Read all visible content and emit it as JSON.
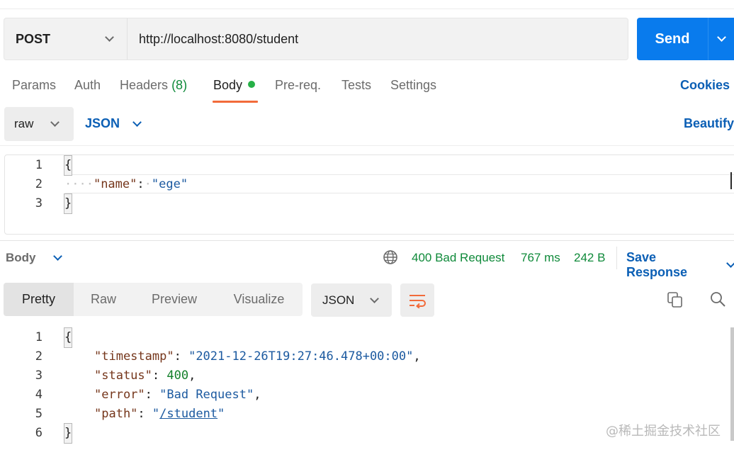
{
  "request": {
    "method": "POST",
    "url": "http://localhost:8080/student",
    "send_label": "Send"
  },
  "request_tabs": {
    "params": "Params",
    "auth": "Auth",
    "headers": "Headers",
    "headers_count": "(8)",
    "body": "Body",
    "prereq": "Pre-req.",
    "tests": "Tests",
    "settings": "Settings",
    "cookies": "Cookies",
    "active": "Body"
  },
  "body_mode": {
    "mode": "raw",
    "language": "JSON",
    "beautify": "Beautify"
  },
  "request_body": {
    "line_numbers": [
      "1",
      "2",
      "3"
    ],
    "open_brace": "{",
    "key": "\"name\"",
    "colon": ":",
    "value": "\"ege\"",
    "close_brace": "}"
  },
  "response": {
    "body_label": "Body",
    "status": "400 Bad Request",
    "time": "767 ms",
    "size": "242 B",
    "save_label": "Save Response"
  },
  "view_tabs": {
    "pretty": "Pretty",
    "raw": "Raw",
    "preview": "Preview",
    "visualize": "Visualize",
    "active": "Pretty",
    "format": "JSON"
  },
  "response_body": {
    "line_numbers": [
      "1",
      "2",
      "3",
      "4",
      "5",
      "6"
    ],
    "open_brace": "{",
    "timestamp_key": "\"timestamp\"",
    "timestamp_value": "\"2021-12-26T19:27:46.478+00:00\"",
    "status_key": "\"status\"",
    "status_value": "400",
    "error_key": "\"error\"",
    "error_value": "\"Bad Request\"",
    "path_key": "\"path\"",
    "path_quote_open": "\"",
    "path_value": "/student",
    "path_quote_close": "\"",
    "close_brace": "}"
  },
  "watermark": "@稀土掘金技术社区",
  "colors": {
    "accent_blue": "#097bed",
    "link_blue": "#0b5fb5",
    "status_green": "#0f8a3a",
    "tab_underline": "#f26b3a",
    "tab_dot": "#26b047"
  },
  "icons": [
    "chevron-down-icon",
    "globe-icon",
    "wrap-lines-icon",
    "copy-icon",
    "search-icon"
  ]
}
